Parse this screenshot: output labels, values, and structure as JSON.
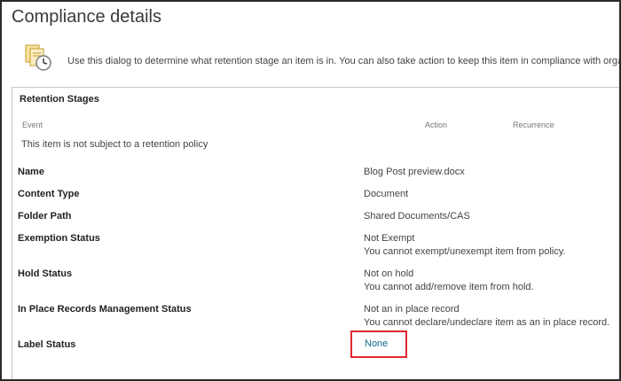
{
  "dialog": {
    "title": "Compliance details",
    "intro": "Use this dialog to determine what retention stage an item is in. You can also take action to keep this item in compliance with organiza",
    "intro_icon": "documents-clock-icon"
  },
  "retention": {
    "section_title": "Retention Stages",
    "columns": [
      "Event",
      "Action",
      "Recurrence"
    ],
    "message": "This item is not subject to a retention policy"
  },
  "properties": [
    {
      "label": "Name",
      "value": "Blog Post preview.docx",
      "note": ""
    },
    {
      "label": "Content Type",
      "value": "Document",
      "note": ""
    },
    {
      "label": "Folder Path",
      "value": "Shared Documents/CAS",
      "note": ""
    },
    {
      "label": "Exemption Status",
      "value": "Not Exempt",
      "note": "You cannot exempt/unexempt item from policy."
    },
    {
      "label": "Hold Status",
      "value": "Not on hold",
      "note": "You cannot add/remove item from hold."
    },
    {
      "label": "In Place Records Management Status",
      "value": "Not an in place record",
      "note": "You cannot declare/undeclare item as an in place record."
    },
    {
      "label": "Label Status",
      "value": "None",
      "note": ""
    }
  ],
  "colors": {
    "link": "#0f6b8a",
    "highlight_border": "#e0282e"
  }
}
